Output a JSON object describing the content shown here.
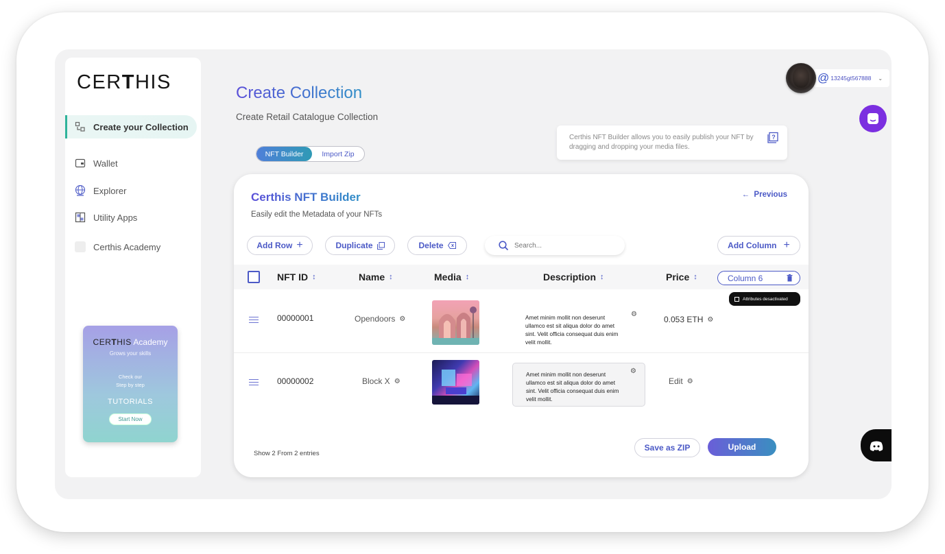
{
  "brand": {
    "logo_pre": "CER",
    "logo_post": "HIS"
  },
  "sidebar": {
    "items": [
      {
        "label": "Create your Collection",
        "icon": "collection-icon",
        "active": true
      },
      {
        "label": "Wallet",
        "icon": "wallet-icon"
      },
      {
        "label": "Explorer",
        "icon": "globe-icon"
      },
      {
        "label": "Utility Apps",
        "icon": "apps-icon"
      },
      {
        "label": "Certhis Academy",
        "icon": "academy-icon"
      }
    ],
    "academy_card": {
      "brand_pre": "CER",
      "brand_post": "HIS",
      "title": "Academy",
      "tagline": "Grows your skills",
      "line1": "Check our",
      "line2": "Step by step",
      "heading": "TUTORIALS",
      "button": "Start Now"
    }
  },
  "header": {
    "title": "Create Collection",
    "subtitle": "Create Retail Catalogue Collection",
    "tabs": [
      {
        "label": "NFT Builder",
        "active": true
      },
      {
        "label": "Import Zip",
        "active": false
      }
    ],
    "hint": "Certhis NFT Builder allows you to easily publish your NFT by dragging and dropping your media files."
  },
  "user": {
    "at": "@",
    "id": "13245gt567888"
  },
  "builder": {
    "title": "Certhis NFT Builder",
    "subtitle": "Easily edit the Metadata of your NFTs",
    "previous": "Previous",
    "toolbar": {
      "add_row": "Add Row",
      "duplicate": "Duplicate",
      "delete": "Delete",
      "search_placeholder": "Search...",
      "add_column": "Add Column"
    },
    "columns": {
      "id": "NFT ID",
      "name": "Name",
      "media": "Media",
      "description": "Description",
      "price": "Price",
      "extra": "Column 6",
      "extra_tooltip": "Attributes desactivated"
    },
    "rows": [
      {
        "id": "00000001",
        "name": "Opendoors",
        "description": "Amet minim mollit non deserunt ullamco est sit aliqua dolor do amet sint. Velit officia consequat duis enim velit mollit.",
        "price": "0.053 ETH"
      },
      {
        "id": "00000002",
        "name": "Block X",
        "description": "Amet minim mollit non deserunt ullamco est sit aliqua dolor do amet sint. Velit officia consequat duis enim velit mollit.",
        "price": "Edit"
      }
    ],
    "footer": {
      "entries": "Show 2 From 2 entries",
      "save_zip": "Save as ZIP",
      "upload": "Upload"
    }
  },
  "colors": {
    "accent": "#4b59c6",
    "teal": "#2fb39a",
    "chat": "#7b2fe0"
  }
}
